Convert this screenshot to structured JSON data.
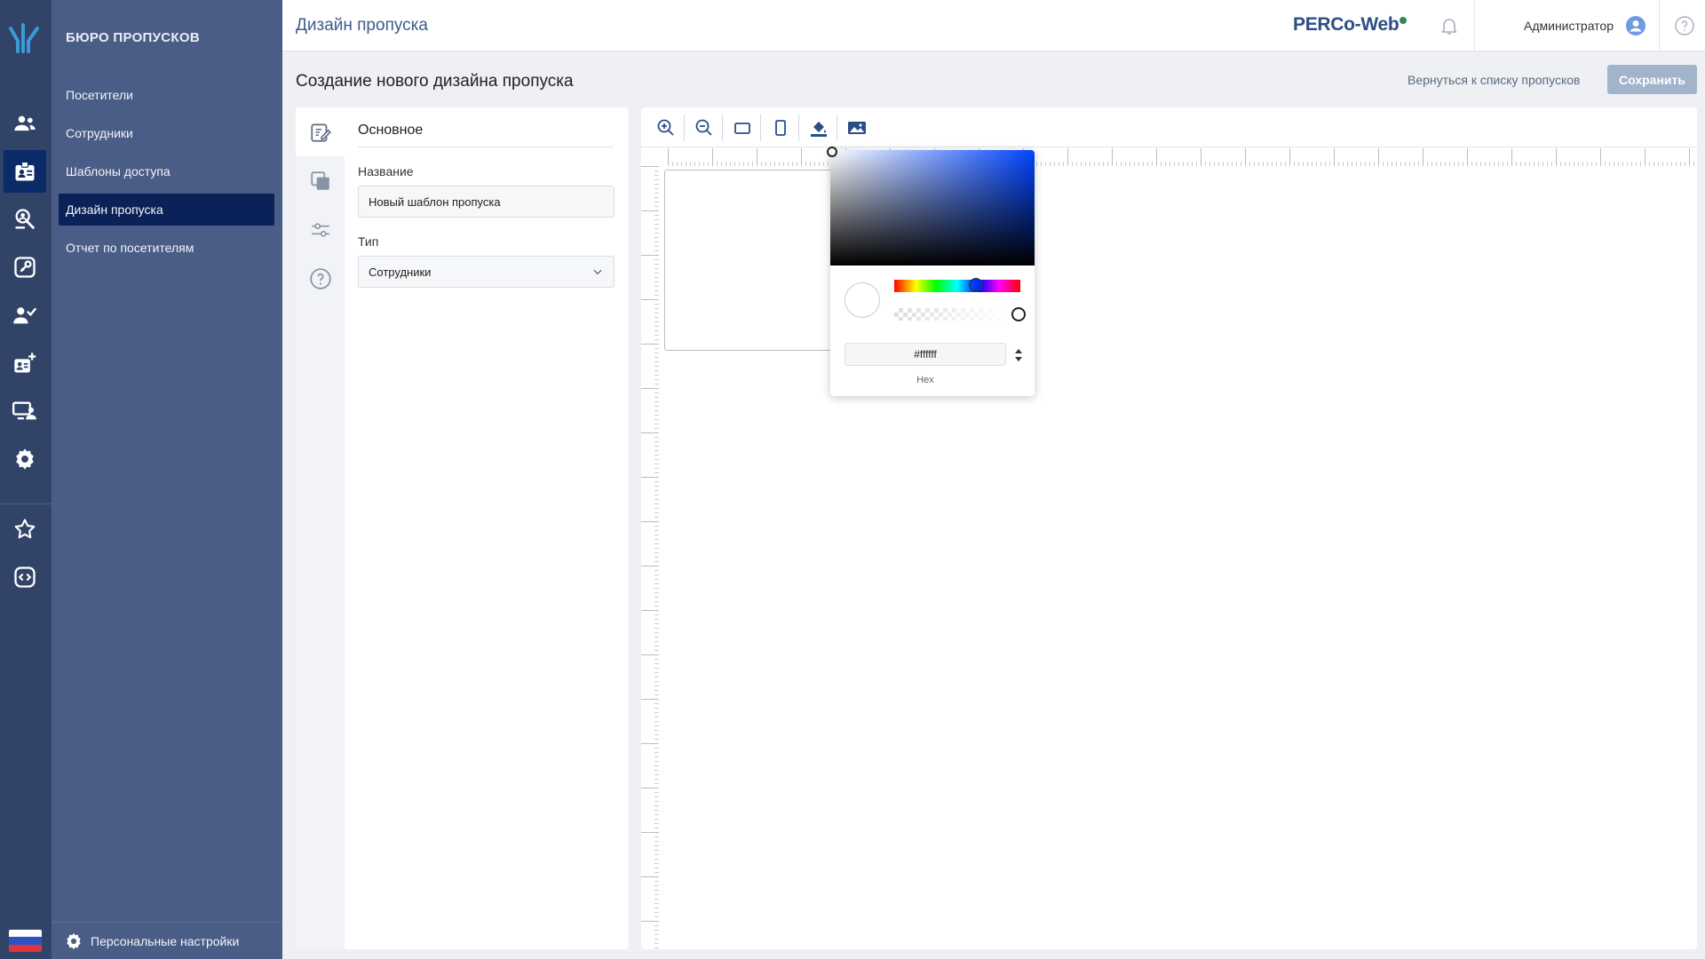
{
  "nav": {
    "title": "БЮРО ПРОПУСКОВ",
    "items": [
      {
        "label": "Посетители"
      },
      {
        "label": "Сотрудники"
      },
      {
        "label": "Шаблоны доступа"
      },
      {
        "label": "Дизайн пропуска",
        "active": true
      },
      {
        "label": "Отчет по посетителям"
      }
    ],
    "bottom_label": "Персональные настройки"
  },
  "rail": {
    "icons": [
      "people-icon",
      "badge-icon",
      "visitor-search-icon",
      "keycard-icon",
      "user-check-icon",
      "badge-add-icon",
      "monitor-user-icon",
      "gear-icon",
      "star-icon",
      "code-icon"
    ],
    "active_index": 1,
    "locale_flag": "russia-flag"
  },
  "header": {
    "title": "Дизайн пропуска",
    "brand": "PERCo-Web",
    "user_name": "Администратор"
  },
  "subheader": {
    "title": "Создание нового дизайна пропуска",
    "back_label": "Вернуться к списку пропусков",
    "save_label": "Сохранить"
  },
  "props": {
    "section_title": "Основное",
    "name_label": "Название",
    "name_value": "Новый шаблон пропуска",
    "type_label": "Тип",
    "type_value": "Сотрудники",
    "tabs": [
      "edit-icon",
      "layers-icon",
      "sliders-icon",
      "help-icon"
    ]
  },
  "picker": {
    "hex_value": "#ffffff",
    "hex_label": "Hex",
    "selected_color": "#ffffff"
  },
  "colors": {
    "rail_bg": "#314468",
    "nav_bg": "#4a5d86",
    "nav_active": "#0a2257",
    "accent": "#2b4e85"
  }
}
